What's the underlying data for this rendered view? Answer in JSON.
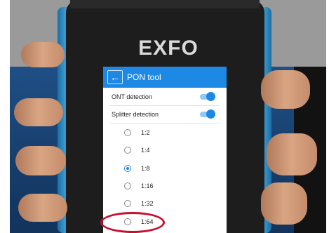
{
  "brand": {
    "logo_text": "EXFO"
  },
  "header": {
    "back_icon": "arrow-left-icon",
    "title": "PON tool"
  },
  "toggles": [
    {
      "label": "ONT detection",
      "on": true
    },
    {
      "label": "Splitter detection",
      "on": true
    }
  ],
  "splitter_options": [
    {
      "label": "1:2",
      "selected": false
    },
    {
      "label": "1:4",
      "selected": false
    },
    {
      "label": "1:8",
      "selected": true
    },
    {
      "label": "1:16",
      "selected": false
    },
    {
      "label": "1:32",
      "selected": false
    },
    {
      "label": "1:64",
      "selected": false
    }
  ],
  "colors": {
    "accent": "#1e88e5",
    "highlight_ring": "#c8102e",
    "device_rail": "#2f8fc8"
  }
}
